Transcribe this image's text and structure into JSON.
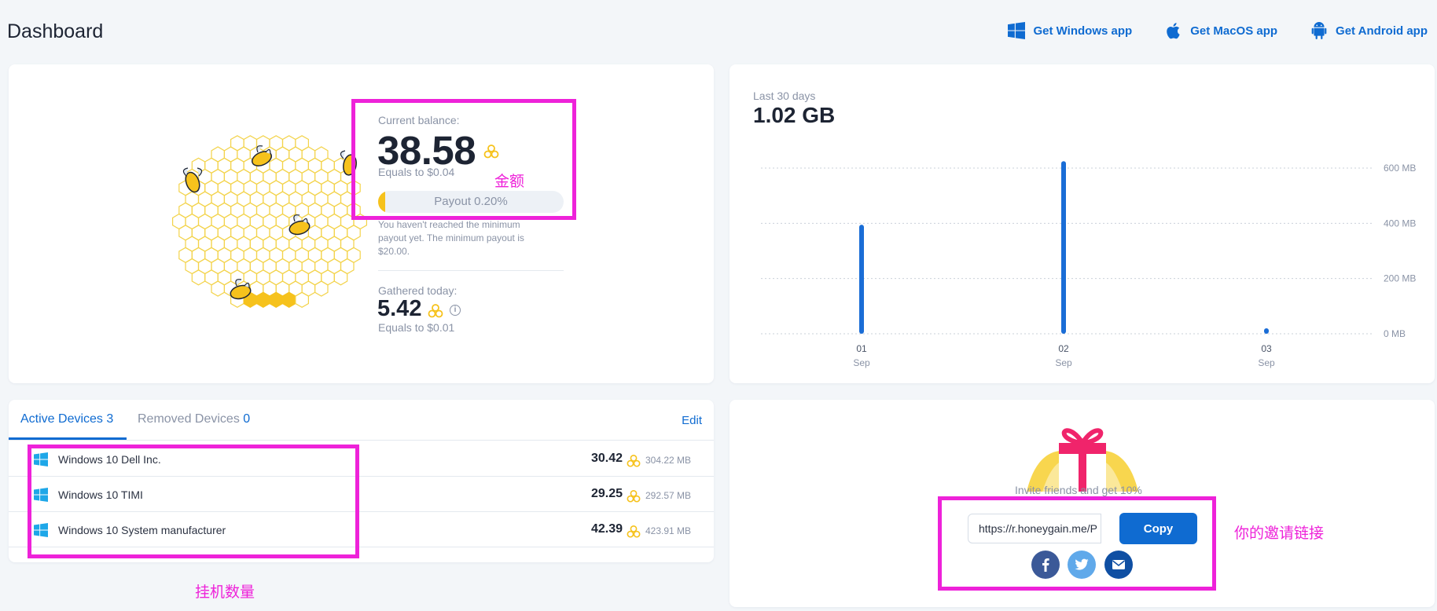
{
  "header": {
    "title": "Dashboard",
    "apps": [
      {
        "label": "Get Windows app",
        "icon": "windows-icon"
      },
      {
        "label": "Get MacOS app",
        "icon": "apple-icon"
      },
      {
        "label": "Get Android app",
        "icon": "android-icon"
      }
    ]
  },
  "balance": {
    "label": "Current balance:",
    "value": "38.58",
    "equals": "Equals to $0.04",
    "payout_label": "Payout 0.20%",
    "payout_progress": 0.002,
    "note": "You haven't reached the minimum payout yet. The minimum payout is $20.00.",
    "today_label": "Gathered today:",
    "today_value": "5.42",
    "today_equals": "Equals to $0.01"
  },
  "traffic": {
    "label": "Last 30 days",
    "value": "1.02 GB"
  },
  "chart_data": {
    "type": "bar",
    "categories": [
      "01",
      "02",
      "03"
    ],
    "category_sublabels": [
      "Sep",
      "Sep",
      "Sep"
    ],
    "values": [
      395,
      625,
      20
    ],
    "ylim": [
      0,
      600
    ],
    "yticks": [
      "0 MB",
      "200 MB",
      "400 MB",
      "600 MB"
    ],
    "grid": true,
    "bar_color": "#1a6dd6"
  },
  "devices": {
    "tab_active_label": "Active Devices",
    "tab_active_count": "3",
    "tab_removed_label": "Removed Devices",
    "tab_removed_count": "0",
    "edit_label": "Edit",
    "rows": [
      {
        "name": "Windows 10 Dell Inc.",
        "value": "30.42",
        "traffic": "304.22 MB"
      },
      {
        "name": "Windows 10 TIMI",
        "value": "29.25",
        "traffic": "292.57 MB"
      },
      {
        "name": "Windows 10 System manufacturer",
        "value": "42.39",
        "traffic": "423.91 MB"
      }
    ]
  },
  "invite": {
    "text": "Invite friends and get 10%",
    "link": "https://r.honeygain.me/P",
    "copy_label": "Copy"
  },
  "annotations": {
    "balance": "金额",
    "devices": "挂机数量",
    "invite": "你的邀请链接"
  },
  "colors": {
    "accent": "#0f6bd1",
    "honey": "#f6c21c",
    "annotation": "#ee22d9"
  }
}
